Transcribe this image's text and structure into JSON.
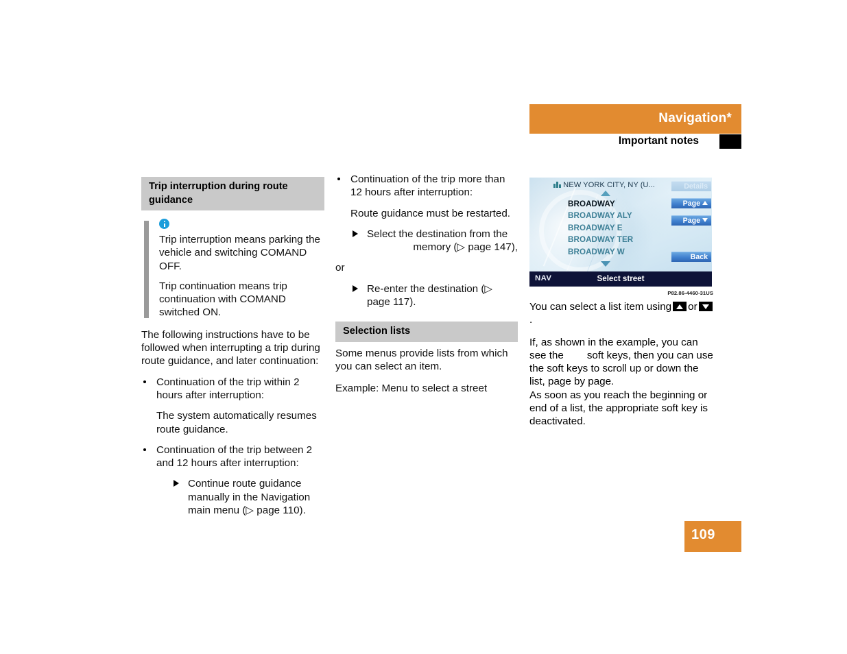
{
  "header": {
    "chapter_title": "Navigation*",
    "section_title": "Important notes",
    "orange_hex": "#e28b30"
  },
  "left_column": {
    "heading": "Trip interruption during route guidance",
    "note": {
      "icon": "info-icon",
      "paragraphs": [
        "Trip interruption means parking the vehicle and switching COMAND OFF.",
        "Trip continuation means trip continuation with COMAND switched ON."
      ]
    },
    "intro": "The following instructions have to be followed when interrupting a trip during route guidance, and later continuation:",
    "bullets": [
      {
        "text": "Continuation of the trip within 2 hours after interruption:",
        "sub": "The system automatically resumes route guidance."
      },
      {
        "text": "Continuation of the trip between 2 and 12 hours after interruption:",
        "step": "Continue route guidance manually in the Navigation main menu (▷ page 110)."
      }
    ]
  },
  "middle_column": {
    "bullet": "Continuation of the trip more than 12 hours after interruption:",
    "sub": "Route guidance must be restarted.",
    "step1_line1": "Select the destination from the",
    "step1_line2": "memory (▷ page 147),",
    "or_word": "or",
    "step2": "Re-enter the destination (▷ page 117).",
    "heading": "Selection lists",
    "para1": "Some menus provide lists from which you can select an item.",
    "para2": "Example: Menu to select a street"
  },
  "screen": {
    "title": "NEW YORK CITY, NY (U...",
    "city_icon": "city-buildings-icon",
    "scroll_up_icon": "triangle-up-icon",
    "scroll_down_icon": "triangle-down-icon",
    "list": [
      {
        "label": "BROADWAY",
        "selected": true
      },
      {
        "label": "BROADWAY ALY",
        "selected": false
      },
      {
        "label": "BROADWAY E",
        "selected": false
      },
      {
        "label": "BROADWAY TER",
        "selected": false
      },
      {
        "label": "BROADWAY W",
        "selected": false
      }
    ],
    "softkeys": [
      {
        "label": "Details",
        "enabled": false
      },
      {
        "label": "Page",
        "arrow": "up",
        "enabled": true
      },
      {
        "label": "Page",
        "arrow": "down",
        "enabled": true
      },
      {
        "label": "Back",
        "enabled": true
      }
    ],
    "status_left": "NAV",
    "status_title": "Select street",
    "figure_code": "P82.86-4460-31US"
  },
  "right_column": {
    "caption_pre": "You can select a list item using",
    "caption_mid": "or",
    "caption_end": ".",
    "para1_a": "If, as shown in the example, you can see the",
    "para1_b": "soft keys, then you can use the soft keys to scroll up or down the list, page by page.",
    "para2": "As soon as you reach the beginning or end of a list, the appropriate soft key is deactivated."
  },
  "footer": {
    "page_number": "109"
  }
}
